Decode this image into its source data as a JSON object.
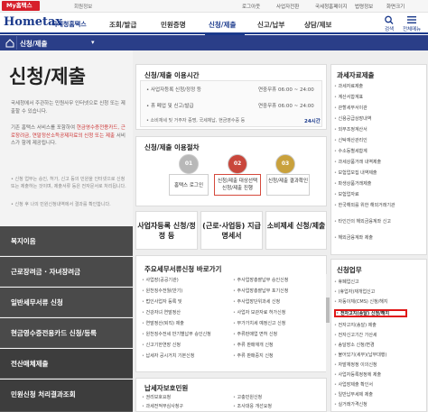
{
  "topbar": {
    "my_badge": "My홈택스",
    "member": "회원정보",
    "links": [
      "로그아웃",
      "사업자전환",
      "국세청홈페이지",
      "법령정보",
      "화면크기"
    ]
  },
  "header": {
    "logo": "Hometax",
    "logo_sub": "국세청홈택스",
    "nav": [
      "조회/발급",
      "민원증명",
      "신청/제출",
      "신고/납부",
      "상담/제보"
    ],
    "icons": [
      {
        "label": "검색",
        "icon": "search-icon"
      },
      {
        "label": "전체메뉴",
        "icon": "menu-icon"
      }
    ]
  },
  "breadcrumb": {
    "label": "신청/제출",
    "arrow": "▾"
  },
  "left": {
    "title": "신청/제출",
    "intro": "국세청에서 주관하는 민원사무 인터넷으로 신청 또는 제출할 수 있습니다.",
    "links_prefix": "기존 홈택스 서비스를 포함하여",
    "links_highlight": "현금영수증전용카드, 근로장려금, 연말정산소득공제자료의 신청 또는 제출",
    "links_suffix": "서비스가 함께 제공됩니다.",
    "note1": "• 신청 업무는 승인, 허가, 신고 등의 민원을 인터넷으로 신청 또는 제출하는 것이며, 제출서류 등은 전자문서로 처리됩니다.",
    "note2": "• 신청 후 나의 민원신청내역에서 결과를 확인합니다.",
    "menu": [
      "복지이음",
      "근로장려금 · 자녀장려금",
      "일반세무서류 신청",
      "현금영수증전용카드 신청/등록",
      "전산매체제출",
      "민원신청 처리결과조회"
    ]
  },
  "usage_time": {
    "title": "신청/제출 이용시간",
    "rows": [
      {
        "label": "• 사업자등록 신청/정정 등",
        "value": "연중무휴 06:00 ~ 24:00"
      },
      {
        "label": "• 휴 폐업 및 신고/발급",
        "value": "연중무휴 06:00 ~ 24:00"
      },
      {
        "label": "• 소비재세 및 거주자 증명, 국세체납, 현금영수증 등",
        "value": "24시간"
      }
    ]
  },
  "procedure": {
    "title": "신청/제출 이용절차",
    "steps": [
      {
        "num": "01",
        "label": "홈택스 로그인"
      },
      {
        "num": "02",
        "label": "신청/제출 대상선택 신청/제출 진행"
      },
      {
        "num": "03",
        "label": "신청/제출 결과확인"
      }
    ]
  },
  "services": [
    "사업자등록 신청/정정 등",
    "(근로·사업등) 지급명세서",
    "소비제세 신청/제출"
  ],
  "tax_data": {
    "title": "과세자료제출",
    "items": [
      "과세자료제출",
      "과세자료제출",
      "계산서합계표",
      "관할세무서이관",
      "신용공급상장내역",
      "외부조정계산서",
      "신탁재산관리인",
      "수소등별세합계",
      "과세상품거래 내역제출",
      "보험업모집 내역제출",
      "파생상품거래제출",
      "보험업자료",
      "한국해외를 위한 해외거래기관",
      "타인간의 해외금융계좌 신고",
      "해외금융계좌 제출"
    ]
  },
  "major_docs": {
    "title": "주요세무서류신청 바로가기",
    "col1": [
      "사업장(공공기관)",
      "원천징수전월(반기)",
      "법인사업자 등록 및",
      "건강자녀 연말정산",
      "연말정산(퇴직) 제출",
      "원천징수전세 반기별납부 승인신청",
      "신고기한연장 신청",
      "납세자 공시거치 기본신청"
    ],
    "col2": [
      "주사업장총괄납부 승인신청",
      "주사업장총괄납부 포기신청",
      "주사업장단위과세 신청",
      "사업자 보관자료 허가신청",
      "부가가치세 예정신고 신청",
      "주류판매업 면허 신청",
      "주류 판매재개 신청",
      "주류 판매중지 신청"
    ]
  },
  "taxpayer_rights": {
    "title": "납세자보호민원",
    "col1": [
      "권리보호요청",
      "권리보호요청",
      "과세전적부심사청구",
      "이의신청",
      "심사청구",
      "납세자보호관"
    ],
    "col2": [
      "고충민원신청",
      "고충민원신청",
      "고충민원신청",
      "고충민원신청",
      "조사대응 개선요청",
      "국세청 체크리스트"
    ]
  },
  "apply_tasks": {
    "title": "신청업무",
    "items": [
      "휴폐업신고",
      "(휴업자)재개업신고",
      "전자고지(송달) 신청/해지",
      "자동이체(CMS) 신청/해지",
      "전자고지(송달) 제출",
      "전자신고기간 가산세",
      "송달장소 신청/변경",
      "불어있기(세무)(납부대행)",
      "자발재정정 이의신청",
      "사업자등록정정에 제출",
      "사업장제출 확인서",
      "일반납부세제 제출",
      "실거래가격신청",
      "중간예납 신청",
      "근로소득공제 신청",
      "보증금 면제 신청"
    ],
    "highlighted": "전자고지(송달) 신청/해지"
  }
}
